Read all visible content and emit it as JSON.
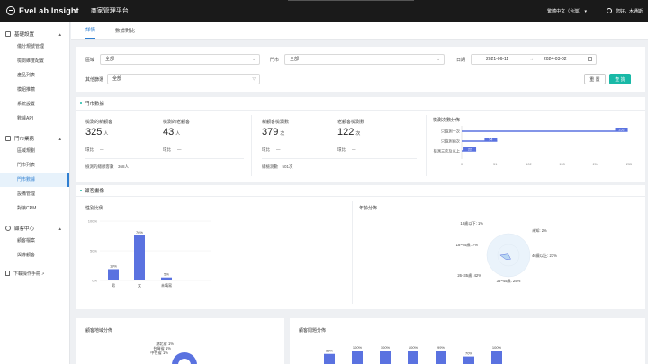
{
  "header": {
    "brand": "EveLab Insight",
    "platform": "商家管理平台",
    "language": "繁體中文（台灣）",
    "user": "您好，木通斯"
  },
  "sidebar": {
    "groups": [
      {
        "label": "基礎設置",
        "items": [
          "儀分規號管理",
          "檢測維度配置",
          "產品列表",
          "模組推薦",
          "系統設置",
          "數據API"
        ]
      },
      {
        "label": "門市業務",
        "items": [
          "區域規劃",
          "門市列表",
          "門市數據",
          "設備管理",
          "對接CRM"
        ]
      },
      {
        "label": "顧客中心",
        "items": [
          "顧客檔案",
          "與導顧客"
        ]
      }
    ],
    "active_item": "門市數據",
    "footer": "下載操作手冊"
  },
  "tabs": [
    {
      "label": "詳情",
      "active": true
    },
    {
      "label": "數據對比",
      "active": false
    }
  ],
  "filter": {
    "region_label": "區域",
    "region_value": "全部",
    "store_label": "門市",
    "store_value": "全部",
    "date_label": "日期",
    "date_start": "2021-06-11",
    "date_sep": "→",
    "date_end": "2024-03-02",
    "other_label": "其他篩選",
    "other_value": "全部",
    "reset_label": "重 置",
    "query_label": "查 詢"
  },
  "store_data": {
    "title": "門市數據",
    "metrics": [
      {
        "label": "檢測的新顧客",
        "value": "325",
        "unit": "人",
        "ratio_label": "環比",
        "ratio": "—"
      },
      {
        "label": "檢測的老顧客",
        "value": "43",
        "unit": "人",
        "ratio_label": "環比",
        "ratio": "—"
      },
      {
        "label": "新顧客檢測數",
        "value": "379",
        "unit": "次",
        "ratio_label": "環比",
        "ratio": "—"
      },
      {
        "label": "老顧客檢測數",
        "value": "122",
        "unit": "次",
        "ratio_label": "環比",
        "ratio": "—"
      }
    ],
    "total_customers": "檢測的總顧客數　368人",
    "total_tests": "總檢測數　501次",
    "freq_title": "檢測次數分佈"
  },
  "customer_profile": {
    "title": "顧客畫像",
    "gender_title": "性別比例",
    "age_title": "年齡分佈",
    "region_title": "顧客地域分佈",
    "skin_title": "顧客問題分佈"
  },
  "chart_data": [
    {
      "type": "bar",
      "orientation": "horizontal",
      "title": "檢測次數分佈",
      "categories": [
        "只檢測一次",
        "只檢測兩次",
        "檢測三次及以上"
      ],
      "values": [
        253,
        54,
        22
      ],
      "xticks": [
        0,
        51,
        102,
        153,
        204,
        255
      ],
      "xlim": [
        0,
        255
      ]
    },
    {
      "type": "bar",
      "title": "性別比例",
      "categories": [
        "男",
        "女",
        "未填寫"
      ],
      "values": [
        19,
        76,
        5
      ],
      "value_labels": [
        "19%",
        "76%",
        "5%"
      ],
      "yticks": [
        "0%",
        "50%",
        "100%"
      ],
      "ylim": [
        0,
        100
      ]
    },
    {
      "type": "radar",
      "title": "年齡分佈",
      "labels": [
        "18歲以下: 1%",
        "未知: 2%",
        "46歲以上: 23%",
        "36~45歲: 25%",
        "26~35歲: 42%",
        "18~25歲: 7%"
      ],
      "values": [
        1,
        2,
        23,
        25,
        42,
        7
      ]
    },
    {
      "type": "pie",
      "title": "顧客地域分佈",
      "labels": [
        "湖北省 1%",
        "台灣省 1%",
        "中性省 1%"
      ]
    },
    {
      "type": "bar",
      "title": "顧客問題分佈",
      "value_labels": [
        "83%",
        "100%",
        "100%",
        "100%",
        "99%",
        "70%",
        "100%"
      ],
      "values": [
        83,
        100,
        100,
        100,
        99,
        70,
        100
      ]
    }
  ],
  "colors": {
    "accent": "#2f7fd1",
    "teal": "#19b9a7",
    "bar": "#5a72e0"
  }
}
